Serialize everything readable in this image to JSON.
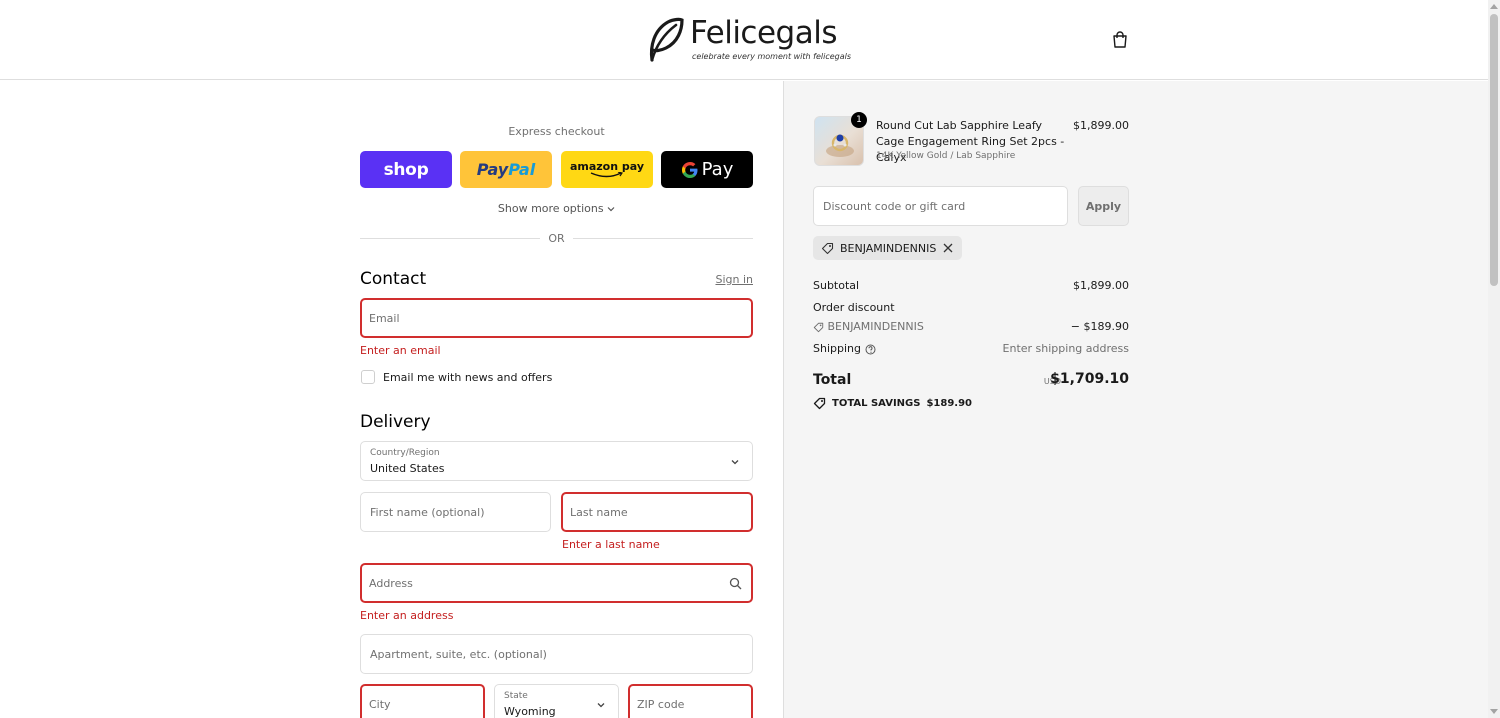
{
  "header": {
    "brand": "Felicegals",
    "tagline": "celebrate every moment with felicegals",
    "cart_icon": "shopping-bag-icon"
  },
  "express": {
    "title": "Express checkout",
    "buttons": {
      "shop": "shop",
      "paypal_1": "Pay",
      "paypal_2": "Pal",
      "amazon": "amazon pay",
      "gpay": "Pay"
    },
    "show_more": "Show more options",
    "or": "OR"
  },
  "contact": {
    "title": "Contact",
    "sign_in": "Sign in",
    "email_placeholder": "Email",
    "email_error": "Enter an email",
    "newsletter_label": "Email me with news and offers"
  },
  "delivery": {
    "title": "Delivery",
    "country_label": "Country/Region",
    "country_value": "United States",
    "first_name_placeholder": "First name (optional)",
    "last_name_placeholder": "Last name",
    "last_name_error": "Enter a last name",
    "address_placeholder": "Address",
    "address_error": "Enter an address",
    "apartment_placeholder": "Apartment, suite, etc. (optional)",
    "city_placeholder": "City",
    "state_label": "State",
    "state_value": "Wyoming",
    "zip_placeholder": "ZIP code"
  },
  "summary": {
    "product": {
      "quantity": "1",
      "name": "Round Cut Lab Sapphire Leafy Cage Engagement Ring Set 2pcs - Calyx",
      "variant": "14K Yellow Gold / Lab Sapphire",
      "price": "$1,899.00"
    },
    "discount_placeholder": "Discount code or gift card",
    "apply_label": "Apply",
    "applied_code": "BENJAMINDENNIS",
    "subtotal_label": "Subtotal",
    "subtotal_value": "$1,899.00",
    "order_discount_label": "Order discount",
    "discount_code": "BENJAMINDENNIS",
    "discount_value": "− $189.90",
    "shipping_label": "Shipping",
    "shipping_value": "Enter shipping address",
    "total_label": "Total",
    "currency": "USD",
    "total_value": "$1,709.10",
    "savings_label": "TOTAL SAVINGS",
    "savings_value": "$189.90"
  },
  "colors": {
    "error": "#d12e2e",
    "shop_purple": "#5a31f4",
    "paypal_yellow": "#ffc439",
    "amazon_yellow": "#ffd814",
    "summary_bg": "#f5f5f5"
  }
}
